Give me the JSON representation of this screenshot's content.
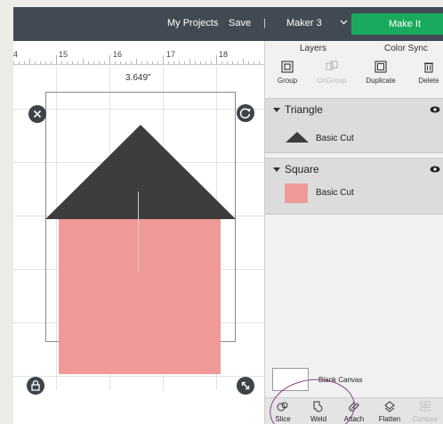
{
  "topbar": {
    "my_projects": "My Projects",
    "save": "Save",
    "separator": "|",
    "machine": "Maker 3",
    "make_it": "Make It",
    "colors": {
      "bar": "#414a53",
      "make_it": "#1aaa5f"
    }
  },
  "ruler": {
    "numbers": [
      "4",
      "15",
      "16",
      "17",
      "18"
    ]
  },
  "canvas": {
    "selection_width": "3.649\"",
    "colors": {
      "triangle": "#3f3d3c",
      "square": "#ef9a98",
      "handle": "#3d4348"
    }
  },
  "panel": {
    "tabs": {
      "layers": "Layers",
      "color_sync": "Color Sync"
    },
    "tools": {
      "group": "Group",
      "ungroup": "UnGroup",
      "duplicate": "Duplicate",
      "delete": "Delete"
    },
    "layers": [
      {
        "name": "Triangle",
        "cut": "Basic Cut"
      },
      {
        "name": "Square",
        "cut": "Basic Cut"
      }
    ],
    "blank_canvas": "Blank Canvas",
    "bottom_tools": {
      "slice": "Slice",
      "weld": "Weld",
      "attach": "Attach",
      "flatten": "Flatten",
      "contour": "Contour"
    }
  }
}
